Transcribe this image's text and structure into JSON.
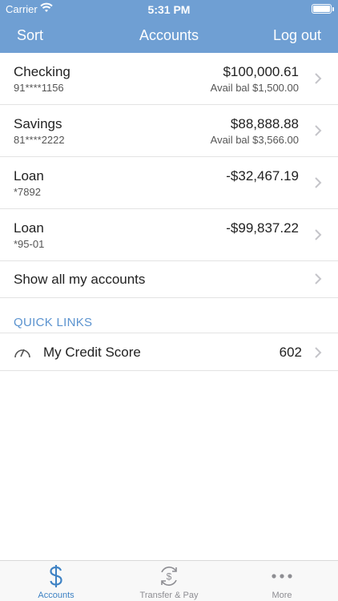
{
  "status_bar": {
    "carrier": "Carrier",
    "time": "5:31 PM"
  },
  "nav": {
    "left": "Sort",
    "title": "Accounts",
    "right": "Log out"
  },
  "accounts": [
    {
      "name": "Checking",
      "number": "91****1156",
      "balance": "$100,000.61",
      "available": "Avail bal $1,500.00"
    },
    {
      "name": "Savings",
      "number": "81****2222",
      "balance": "$88,888.88",
      "available": "Avail bal $3,566.00"
    },
    {
      "name": "Loan",
      "number": "*7892",
      "balance": "-$32,467.19",
      "available": ""
    },
    {
      "name": "Loan",
      "number": "*95-01",
      "balance": "-$99,837.22",
      "available": ""
    }
  ],
  "show_all": "Show all my accounts",
  "quick_links": {
    "heading": "QUICK LINKS",
    "items": [
      {
        "label": "My Credit Score",
        "value": "602",
        "icon": "gauge-icon"
      }
    ]
  },
  "tabs": [
    {
      "label": "Accounts",
      "icon": "dollar-icon",
      "active": true
    },
    {
      "label": "Transfer & Pay",
      "icon": "transfer-icon",
      "active": false
    },
    {
      "label": "More",
      "icon": "more-icon",
      "active": false
    }
  ],
  "colors": {
    "header": "#6f9fd3",
    "accent": "#3e82c4",
    "inactive": "#8e8e93"
  }
}
